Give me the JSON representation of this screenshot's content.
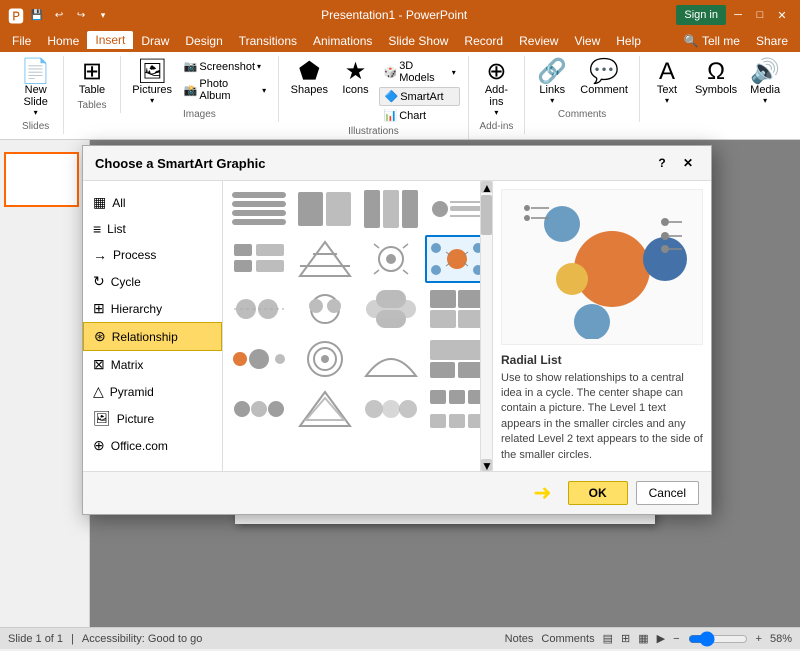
{
  "titlebar": {
    "title": "Presentation1 - PowerPoint",
    "signin": "Sign in",
    "quicksave": "💾",
    "undo": "↩",
    "redo": "↪",
    "minimize": "🗕",
    "maximize": "🗖",
    "close": "✕"
  },
  "menubar": {
    "items": [
      "File",
      "Home",
      "Insert",
      "Draw",
      "Design",
      "Transitions",
      "Animations",
      "Slide Show",
      "Record",
      "Review",
      "View",
      "Help",
      "Tell me",
      "Share"
    ]
  },
  "ribbon": {
    "groups": [
      {
        "label": "Slides",
        "items": [
          "New Slide"
        ]
      },
      {
        "label": "Tables",
        "items": [
          "Table"
        ]
      },
      {
        "label": "Images",
        "items": [
          "Pictures",
          "Screenshot",
          "Photo Album"
        ]
      },
      {
        "label": "Illustrations",
        "items": [
          "Shapes",
          "Icons",
          "3D Models",
          "SmartArt",
          "Chart"
        ]
      },
      {
        "label": "Add-ins",
        "items": [
          "Add-ins"
        ]
      },
      {
        "label": "",
        "items": [
          "Links",
          "Comment",
          "Text",
          "Symbols",
          "Media"
        ]
      }
    ]
  },
  "dialog": {
    "title": "Choose a SmartArt Graphic",
    "help": "?",
    "close": "✕",
    "categories": [
      {
        "id": "all",
        "label": "All",
        "icon": "▦"
      },
      {
        "id": "list",
        "label": "List",
        "icon": "≡"
      },
      {
        "id": "process",
        "label": "Process",
        "icon": "→"
      },
      {
        "id": "cycle",
        "label": "Cycle",
        "icon": "↻"
      },
      {
        "id": "hierarchy",
        "label": "Hierarchy",
        "icon": "⊞"
      },
      {
        "id": "relationship",
        "label": "Relationship",
        "icon": "⊛",
        "active": true
      },
      {
        "id": "matrix",
        "label": "Matrix",
        "icon": "⊠"
      },
      {
        "id": "pyramid",
        "label": "Pyramid",
        "icon": "△"
      },
      {
        "id": "picture",
        "label": "Picture",
        "icon": "🖼"
      },
      {
        "id": "office",
        "label": "Office.com",
        "icon": "⊕"
      }
    ],
    "selected_item": "Radial List",
    "preview_title": "Radial List",
    "preview_desc": "Use to show relationships to a central idea in a cycle. The center shape can contain a picture. The Level 1 text appears in the smaller circles and any related Level 2 text appears to the side of the smaller circles.",
    "ok_label": "OK",
    "cancel_label": "Cancel"
  },
  "statusbar": {
    "slide_info": "Slide 1 of 1",
    "accessibility": "Accessibility: Good to go",
    "notes": "Notes",
    "comments": "Comments",
    "zoom": "58%"
  }
}
